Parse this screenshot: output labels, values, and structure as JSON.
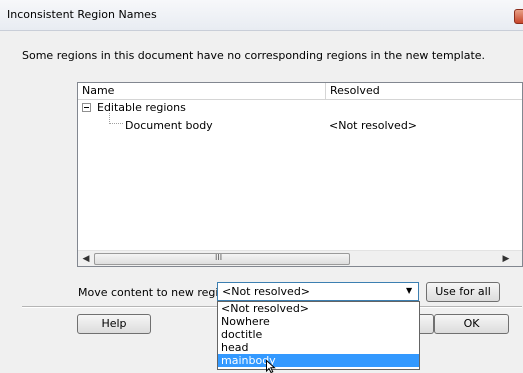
{
  "window": {
    "title": "Inconsistent Region Names"
  },
  "intro": "Some regions in this document have no corresponding regions in the new template.",
  "tree": {
    "columns": {
      "name": "Name",
      "resolved": "Resolved"
    },
    "group": {
      "label": "Editable regions",
      "expanded": true
    },
    "rows": [
      {
        "name": "Document body",
        "resolved": "<Not resolved>"
      }
    ],
    "scroll_grip": "III"
  },
  "move": {
    "label": "Move content to new region:",
    "selected": "<Not resolved>",
    "options": [
      "<Not resolved>",
      "Nowhere",
      "doctitle",
      "head",
      "mainbody"
    ],
    "highlighted_index": 4
  },
  "buttons": {
    "use_for_all": "Use for all",
    "help": "Help",
    "ok": "OK"
  },
  "colors": {
    "highlight": "#3399ff",
    "select_border": "#3c7fb1"
  },
  "icons": {
    "close": "close-icon",
    "dropdown_arrow": "chevron-down-icon",
    "cursor": "mouse-pointer-icon"
  }
}
